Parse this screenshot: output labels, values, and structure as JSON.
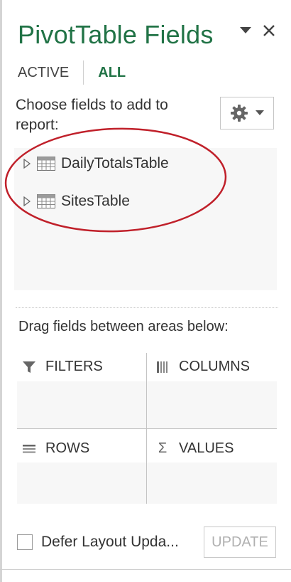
{
  "header": {
    "title": "PivotTable Fields",
    "dropdown_icon": "triangle-down-icon",
    "close_icon": "close-icon"
  },
  "tabs": [
    {
      "label": "ACTIVE",
      "selected": false
    },
    {
      "label": "ALL",
      "selected": true
    }
  ],
  "fields": {
    "instruction": "Choose fields to add to report:",
    "settings_icon": "gear-icon",
    "tables": [
      {
        "name": "DailyTotalsTable",
        "icon": "table-icon",
        "expanded": false
      },
      {
        "name": "SitesTable",
        "icon": "table-icon",
        "expanded": false
      }
    ],
    "annotation_color": "#c0202a"
  },
  "areas": {
    "instruction": "Drag fields between areas below:",
    "filters": {
      "label": "FILTERS",
      "icon": "filter-icon"
    },
    "columns": {
      "label": "COLUMNS",
      "icon": "columns-icon"
    },
    "rows": {
      "label": "ROWS",
      "icon": "rows-icon"
    },
    "values": {
      "label": "VALUES",
      "icon": "sigma-icon"
    }
  },
  "footer": {
    "defer_label": "Defer Layout Upda...",
    "defer_checked": false,
    "update_label": "UPDATE",
    "update_enabled": false
  },
  "colors": {
    "accent": "#217346",
    "zone_background": "#f7f7f7",
    "annotation": "#c0202a"
  }
}
